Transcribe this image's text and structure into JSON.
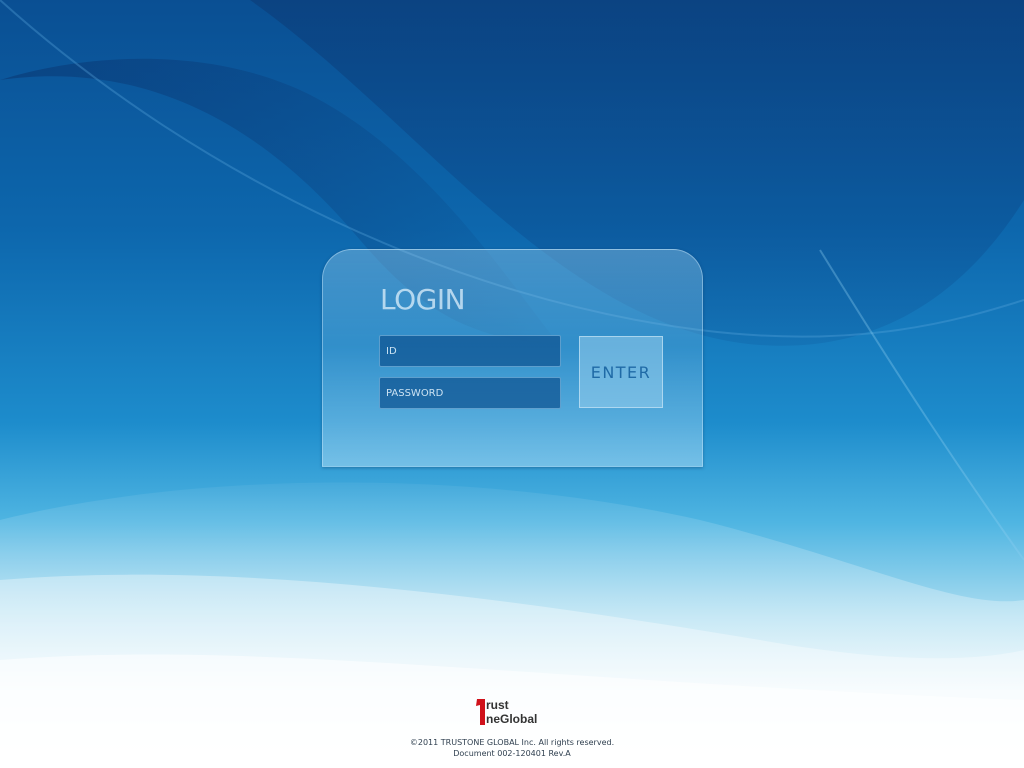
{
  "login": {
    "title": "LOGIN",
    "id_placeholder": "ID",
    "password_placeholder": "PASSWORD",
    "enter_label": "ENTER"
  },
  "footer": {
    "logo_text": "TrustOneGlobal",
    "copyright": "©2011 TRUSTONE GLOBAL Inc. All rights reserved.",
    "document": "Document 002-120401 Rev.A"
  },
  "colors": {
    "background_top": "#0a4f93",
    "background_bottom": "#ffffff",
    "enter_text": "#1f6aa6",
    "logo_red": "#d0121b",
    "logo_dark": "#333333"
  },
  "icons": {
    "logo": "trustoneglobal-logo"
  }
}
